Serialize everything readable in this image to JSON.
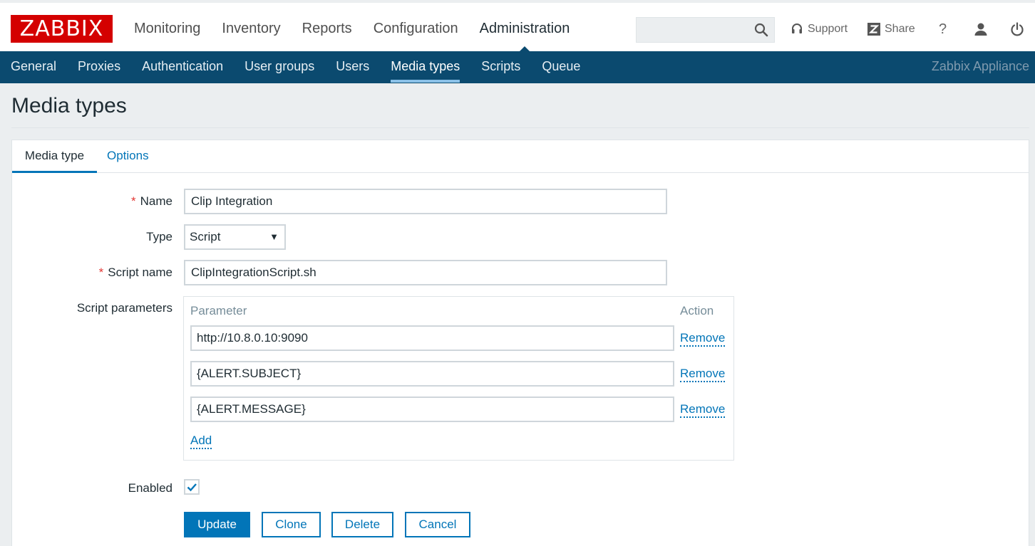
{
  "logo": "ZABBIX",
  "main_nav": [
    "Monitoring",
    "Inventory",
    "Reports",
    "Configuration",
    "Administration"
  ],
  "main_nav_active": "Administration",
  "search": {
    "value": "",
    "placeholder": ""
  },
  "header_tools": {
    "support": "Support",
    "share": "Share",
    "help": "?"
  },
  "sub_nav": [
    "General",
    "Proxies",
    "Authentication",
    "User groups",
    "Users",
    "Media types",
    "Scripts",
    "Queue"
  ],
  "sub_nav_active": "Media types",
  "appliance": "Zabbix Appliance",
  "page_title": "Media types",
  "tabs": {
    "media_type": "Media type",
    "options": "Options"
  },
  "form": {
    "name_label": "Name",
    "name_value": "Clip Integration",
    "type_label": "Type",
    "type_value": "Script",
    "script_name_label": "Script name",
    "script_name_value": "ClipIntegrationScript.sh",
    "script_params_label": "Script parameters",
    "params_header": {
      "parameter": "Parameter",
      "action": "Action"
    },
    "params": [
      "http://10.8.0.10:9090",
      "{ALERT.SUBJECT}",
      "{ALERT.MESSAGE}"
    ],
    "remove_label": "Remove",
    "add_label": "Add",
    "enabled_label": "Enabled",
    "enabled": true,
    "required_marker": "*"
  },
  "buttons": {
    "update": "Update",
    "clone": "Clone",
    "delete": "Delete",
    "cancel": "Cancel"
  },
  "colors": {
    "brand_red": "#d40000",
    "subnav_bg": "#0b4a6f",
    "link_blue": "#0275b8",
    "required_red": "#e33734"
  }
}
